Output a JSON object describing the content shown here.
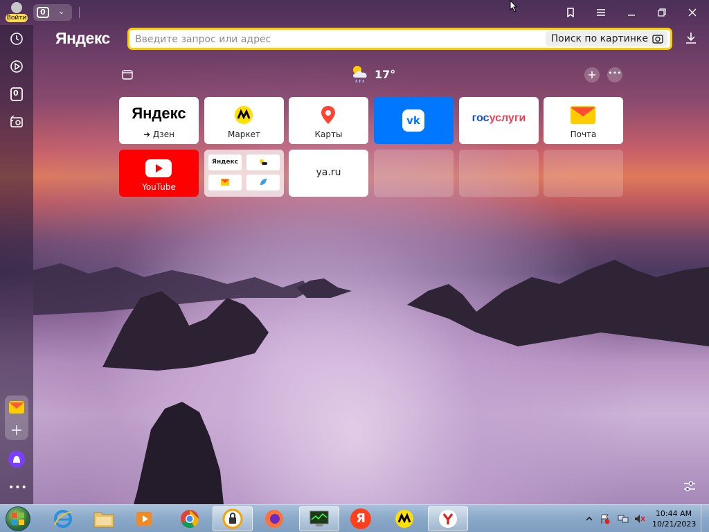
{
  "browser": {
    "login_label": "Войти",
    "tabs_count": "0",
    "logo": "Яндекс",
    "address_placeholder": "Введите запрос или адрес",
    "image_search_label": "Поиск по картинке",
    "accent_color": "#ffcc00"
  },
  "sidebar": {
    "items": [
      {
        "name": "history-icon"
      },
      {
        "name": "video-icon"
      },
      {
        "name": "tabs-counter-icon",
        "label": "0"
      },
      {
        "name": "screenshot-icon"
      }
    ]
  },
  "weather": {
    "temp": "17°",
    "icon": "cloud-rain-sun-icon"
  },
  "tiles": [
    {
      "id": "yandex-dzen",
      "title": "Яндекс",
      "caption": "➜ Дзен"
    },
    {
      "id": "market",
      "caption": "Маркет"
    },
    {
      "id": "maps",
      "caption": "Карты"
    },
    {
      "id": "vk",
      "logo_text": "vk"
    },
    {
      "id": "gosuslugi",
      "logo_text_a": "гос",
      "logo_text_b": "услуги"
    },
    {
      "id": "mail",
      "caption": "Почта"
    },
    {
      "id": "youtube",
      "caption": "YouTube"
    },
    {
      "id": "folder",
      "mini_title": "Яндекс"
    },
    {
      "id": "ya-ru",
      "caption": "ya.ru"
    }
  ],
  "taskbar": {
    "time": "10:44 AM",
    "date": "10/21/2023"
  }
}
